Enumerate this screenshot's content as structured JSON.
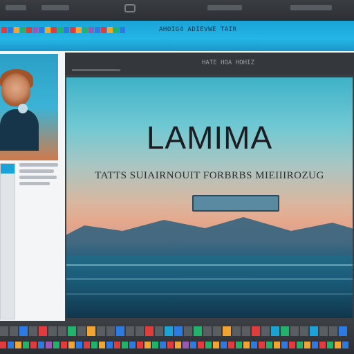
{
  "tab_strip": {
    "text": "AHOIG4 ADIEVWE TAIR"
  },
  "content_window": {
    "url_text": "HATE HOA HOHIZ",
    "hero": {
      "title": "LAMIMA",
      "subtitle": "TATTS SUIAIRNOUIT FORBRBS MIEIIIROZUG"
    }
  },
  "colors": {
    "accent": "#1aa3d6",
    "chrome_dark": "#2b2e33"
  },
  "top_tiles": [
    "#e23b3b",
    "#2c7be5",
    "#f2a431",
    "#1fb36b",
    "#e23b3b",
    "#9b59b6",
    "#2c7be5",
    "#f2a431",
    "#e23b3b",
    "#1fb36b",
    "#2c7be5",
    "#e23b3b",
    "#f2a431",
    "#1fb36b",
    "#9b59b6",
    "#2c7be5",
    "#e23b3b",
    "#f2a431",
    "#1fb36b",
    "#2c7be5"
  ],
  "bottom_tiles_row1": [
    "#5a5e63",
    "#5a5e63",
    "#2c7be5",
    "#5a5e63",
    "#e23b3b",
    "#5a5e63",
    "#5a5e63",
    "#1fb36b",
    "#5a5e63",
    "#f2a431",
    "#5a5e63",
    "#5a5e63",
    "#2c7be5",
    "#5a5e63",
    "#5a5e63",
    "#e23b3b",
    "#5a5e63",
    "#1aa3d6",
    "#2c7be5",
    "#5a5e63",
    "#1fb36b",
    "#5a5e63",
    "#5a5e63",
    "#f2a431",
    "#5a5e63",
    "#5a5e63",
    "#e23b3b",
    "#5a5e63",
    "#1aa3d6",
    "#1fb36b",
    "#5a5e63",
    "#5a5e63",
    "#1aa3d6",
    "#5a5e63",
    "#5a5e63",
    "#2c7be5"
  ],
  "bottom_tiles_row2": [
    "#e23b3b",
    "#2c7be5",
    "#f2a431",
    "#1fb36b",
    "#e23b3b",
    "#2c7be5",
    "#9b59b6",
    "#1fb36b",
    "#e23b3b",
    "#f2a431",
    "#2c7be5",
    "#e23b3b",
    "#1fb36b",
    "#f2a431",
    "#2c7be5",
    "#e23b3b",
    "#1fb36b",
    "#2c7be5",
    "#e23b3b",
    "#f2a431",
    "#1fb36b",
    "#2c7be5",
    "#e23b3b",
    "#f2a431",
    "#9b59b6",
    "#2c7be5",
    "#e23b3b",
    "#1fb36b",
    "#f2a431",
    "#2c7be5",
    "#e23b3b",
    "#1fb36b",
    "#f2a431",
    "#2c7be5",
    "#e23b3b",
    "#1fb36b",
    "#f2a431",
    "#2c7be5",
    "#e23b3b",
    "#1fb36b",
    "#f2a431",
    "#2c7be5",
    "#e23b3b",
    "#1fb36b",
    "#f2a431",
    "#2c7be5"
  ]
}
